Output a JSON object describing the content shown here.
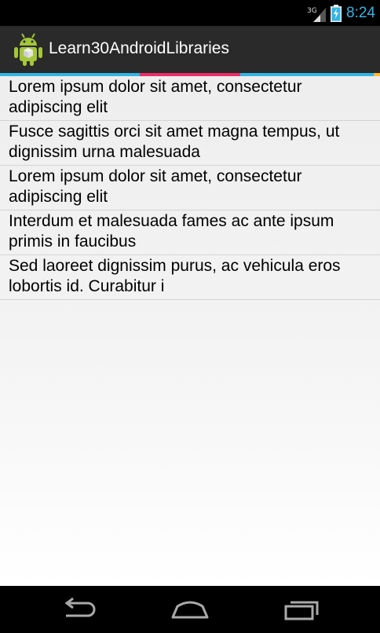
{
  "status_bar": {
    "network": "3G",
    "time": "8:24",
    "icons": [
      "signal-icon",
      "battery-charging-icon"
    ]
  },
  "action_bar": {
    "title": "Learn30AndroidLibraries",
    "icon": "android-app-icon"
  },
  "accent_colors": [
    "#33b5e5",
    "#ee2c6a",
    "#33b5e5",
    "#ffbb33"
  ],
  "list": {
    "items": [
      "Lorem ipsum dolor sit amet, consectetur adipiscing elit",
      "Fusce sagittis orci sit amet magna tempus, ut dignissim urna malesuada",
      "Lorem ipsum dolor sit amet, consectetur adipiscing elit",
      "Interdum et malesuada fames ac ante ipsum primis in faucibus",
      "Sed laoreet dignissim purus, ac vehicula eros lobortis id. Curabitur i"
    ]
  },
  "nav_bar": {
    "buttons": [
      "back-icon",
      "home-icon",
      "recents-icon"
    ]
  }
}
